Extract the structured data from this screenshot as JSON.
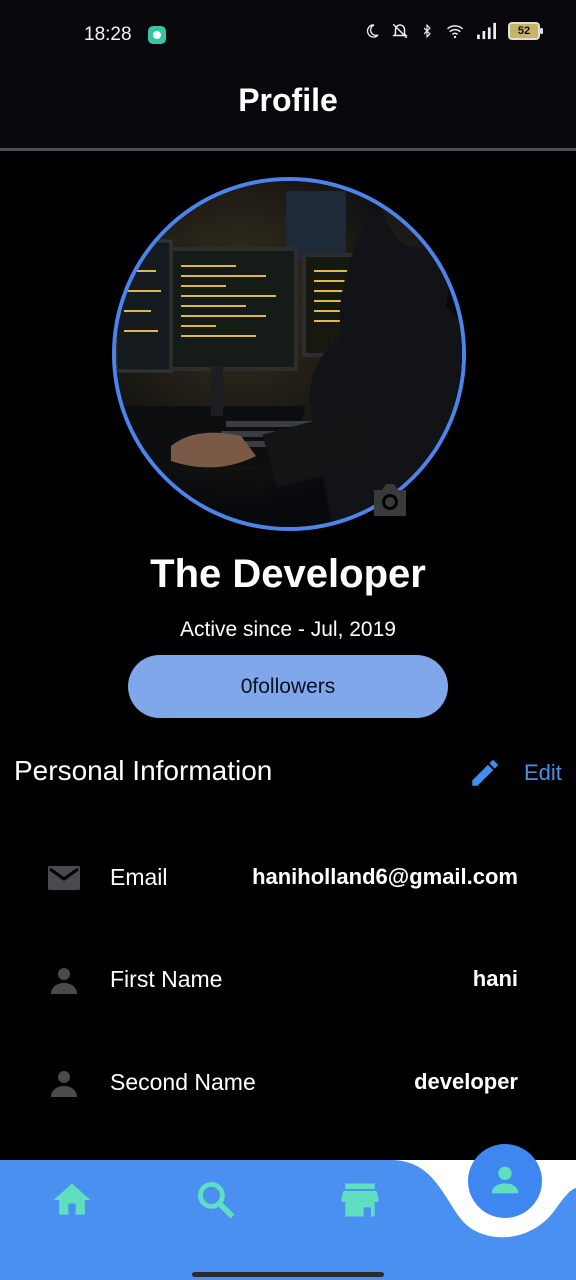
{
  "status_bar": {
    "time": "18:28",
    "battery": "52"
  },
  "app_bar": {
    "title": "Profile"
  },
  "profile": {
    "name": "The Developer",
    "active_since": "Active since - Jul, 2019",
    "followers": "0followers"
  },
  "personal_info": {
    "title": "Personal Information",
    "edit_label": "Edit",
    "rows": [
      {
        "icon": "email-icon",
        "label": "Email",
        "value": "haniholland6@gmail.com"
      },
      {
        "icon": "person-icon",
        "label": "First Name",
        "value": "hani"
      },
      {
        "icon": "person-icon",
        "label": "Second Name",
        "value": "developer"
      }
    ]
  },
  "colors": {
    "accent": "#4d84ec",
    "nav_bar": "#4a90f0",
    "nav_icon": "#5ee0c0",
    "followers_pill": "#7fa7ea",
    "edit_link": "#4a90e2"
  },
  "bottom_nav": {
    "items": [
      "home-icon",
      "search-icon",
      "store-icon",
      "profile-icon"
    ],
    "selected": "profile-icon"
  }
}
